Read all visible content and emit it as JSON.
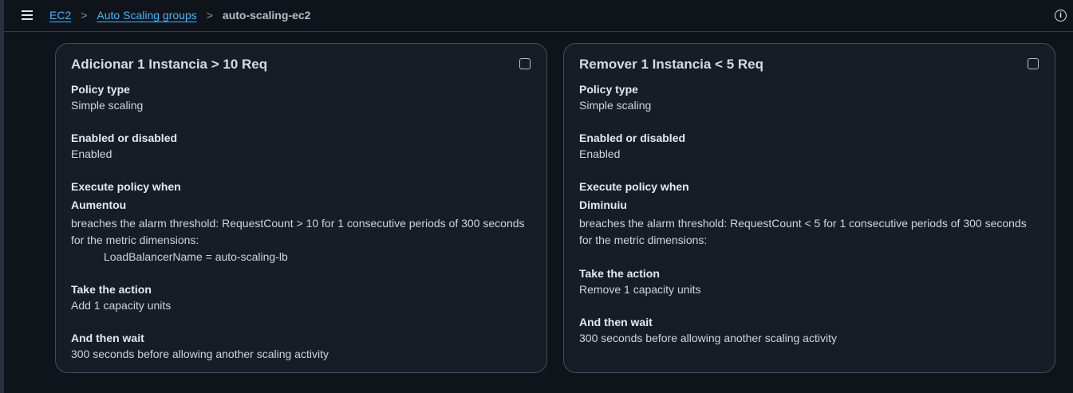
{
  "breadcrumb": {
    "items": [
      "EC2",
      "Auto Scaling groups"
    ],
    "separator": ">",
    "current": "auto-scaling-ec2"
  },
  "icons": {
    "menu": "hamburger-menu-icon",
    "info": "info-icon",
    "info_glyph": "i"
  },
  "policies": [
    {
      "title": "Adicionar 1 Instancia > 10 Req",
      "policy_type_label": "Policy type",
      "policy_type": "Simple scaling",
      "enabled_label": "Enabled or disabled",
      "enabled": "Enabled",
      "execute_label": "Execute policy when",
      "alarm_name": "Aumentou",
      "breach_text": "breaches the alarm threshold: RequestCount > 10 for 1 consecutive periods of 300 seconds for the metric dimensions:",
      "dimension": "LoadBalancerName = auto-scaling-lb",
      "action_label": "Take the action",
      "action": "Add 1 capacity units",
      "wait_label": "And then wait",
      "wait": "300 seconds before allowing another scaling activity"
    },
    {
      "title": "Remover 1 Instancia < 5 Req",
      "policy_type_label": "Policy type",
      "policy_type": "Simple scaling",
      "enabled_label": "Enabled or disabled",
      "enabled": "Enabled",
      "execute_label": "Execute policy when",
      "alarm_name": "Diminuiu",
      "breach_text": "breaches the alarm threshold: RequestCount < 5 for 1 consecutive periods of 300 seconds for the metric dimensions:",
      "action_label": "Take the action",
      "action": "Remove 1 capacity units",
      "wait_label": "And then wait",
      "wait": "300 seconds before allowing another scaling activity"
    }
  ],
  "colors": {
    "link": "#42b4ff",
    "background": "#0f141a",
    "card_background": "#161d26",
    "card_border": "#414d5c"
  }
}
